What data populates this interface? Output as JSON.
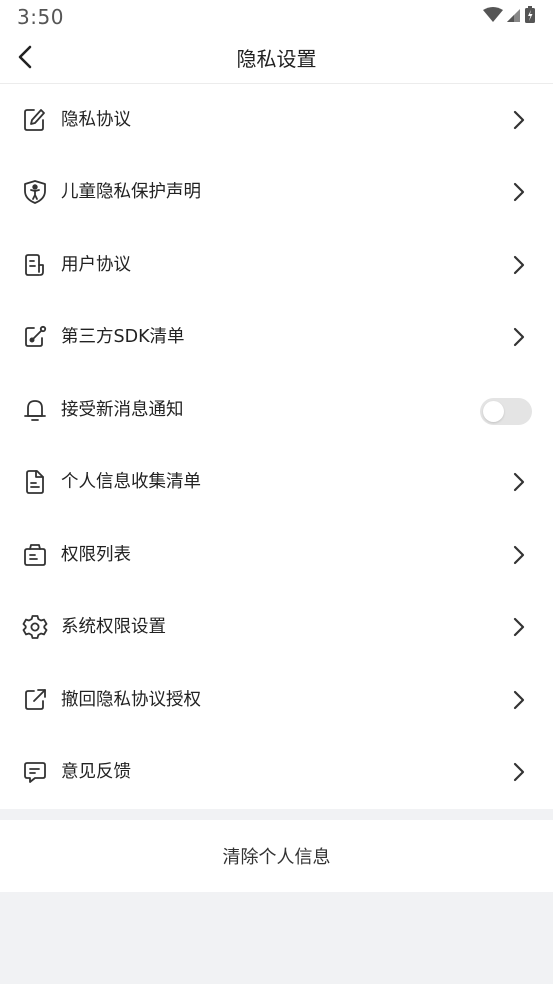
{
  "status_bar": {
    "time": "3:50"
  },
  "header": {
    "title": "隐私设置"
  },
  "items": [
    {
      "label": "隐私协议",
      "icon": "edit-doc-icon",
      "control": "chevron"
    },
    {
      "label": "儿童隐私保护声明",
      "icon": "shield-child-icon",
      "control": "chevron"
    },
    {
      "label": "用户协议",
      "icon": "document-icon",
      "control": "chevron"
    },
    {
      "label": "第三方SDK清单",
      "icon": "link-edit-icon",
      "control": "chevron"
    },
    {
      "label": "接受新消息通知",
      "icon": "bell-icon",
      "control": "toggle",
      "enabled": false
    },
    {
      "label": "个人信息收集清单",
      "icon": "file-list-icon",
      "control": "chevron"
    },
    {
      "label": "权限列表",
      "icon": "bag-icon",
      "control": "chevron"
    },
    {
      "label": "系统权限设置",
      "icon": "gear-icon",
      "control": "chevron"
    },
    {
      "label": "撤回隐私协议授权",
      "icon": "share-out-icon",
      "control": "chevron"
    },
    {
      "label": "意见反馈",
      "icon": "chat-icon",
      "control": "chevron"
    }
  ],
  "clear_button": {
    "label": "清除个人信息"
  },
  "colors": {
    "background": "#f1f2f4",
    "surface": "#ffffff",
    "text": "#222222",
    "toggle_off": "#e4e4e4"
  }
}
